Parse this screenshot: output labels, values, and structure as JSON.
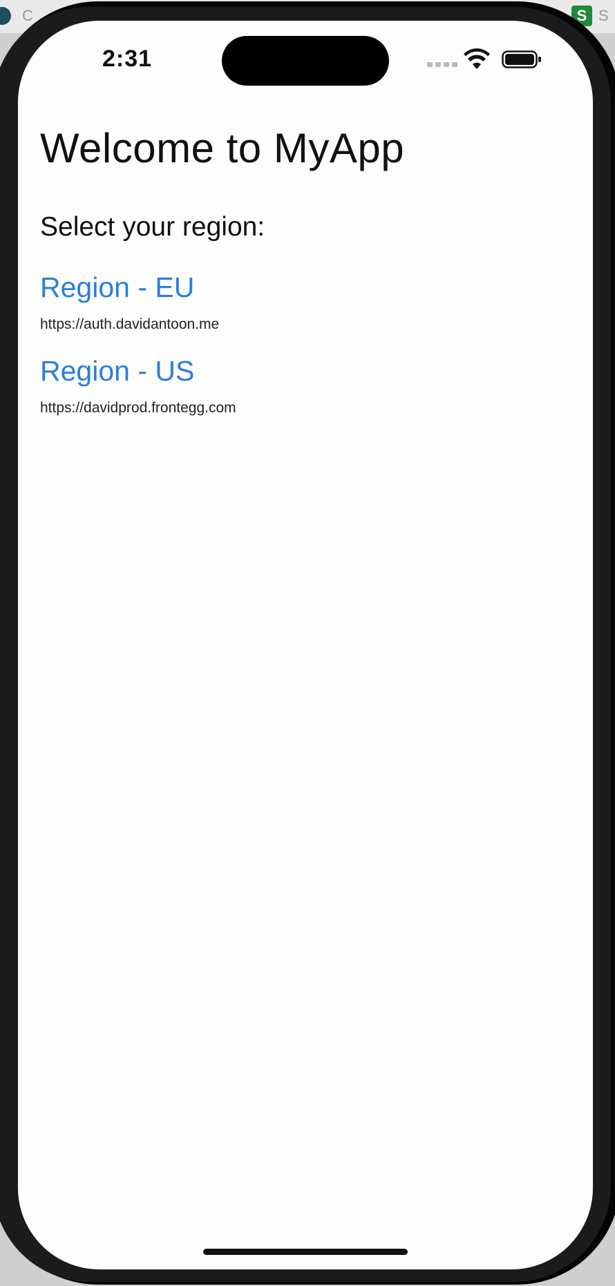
{
  "background": {
    "left_text": "C",
    "right_icon_letter": "S",
    "right_text": "S"
  },
  "status_bar": {
    "time": "2:31",
    "icons": [
      "signal-icon",
      "wifi-icon",
      "battery-icon"
    ]
  },
  "page": {
    "title": "Welcome to MyApp",
    "subtitle": "Select your region:"
  },
  "regions": [
    {
      "label": "Region - EU",
      "url": "https://auth.davidantoon.me"
    },
    {
      "label": "Region - US",
      "url": "https://davidprod.frontegg.com"
    }
  ],
  "colors": {
    "link": "#2a7fd9",
    "text": "#111111",
    "background": "#fdfdfd"
  }
}
